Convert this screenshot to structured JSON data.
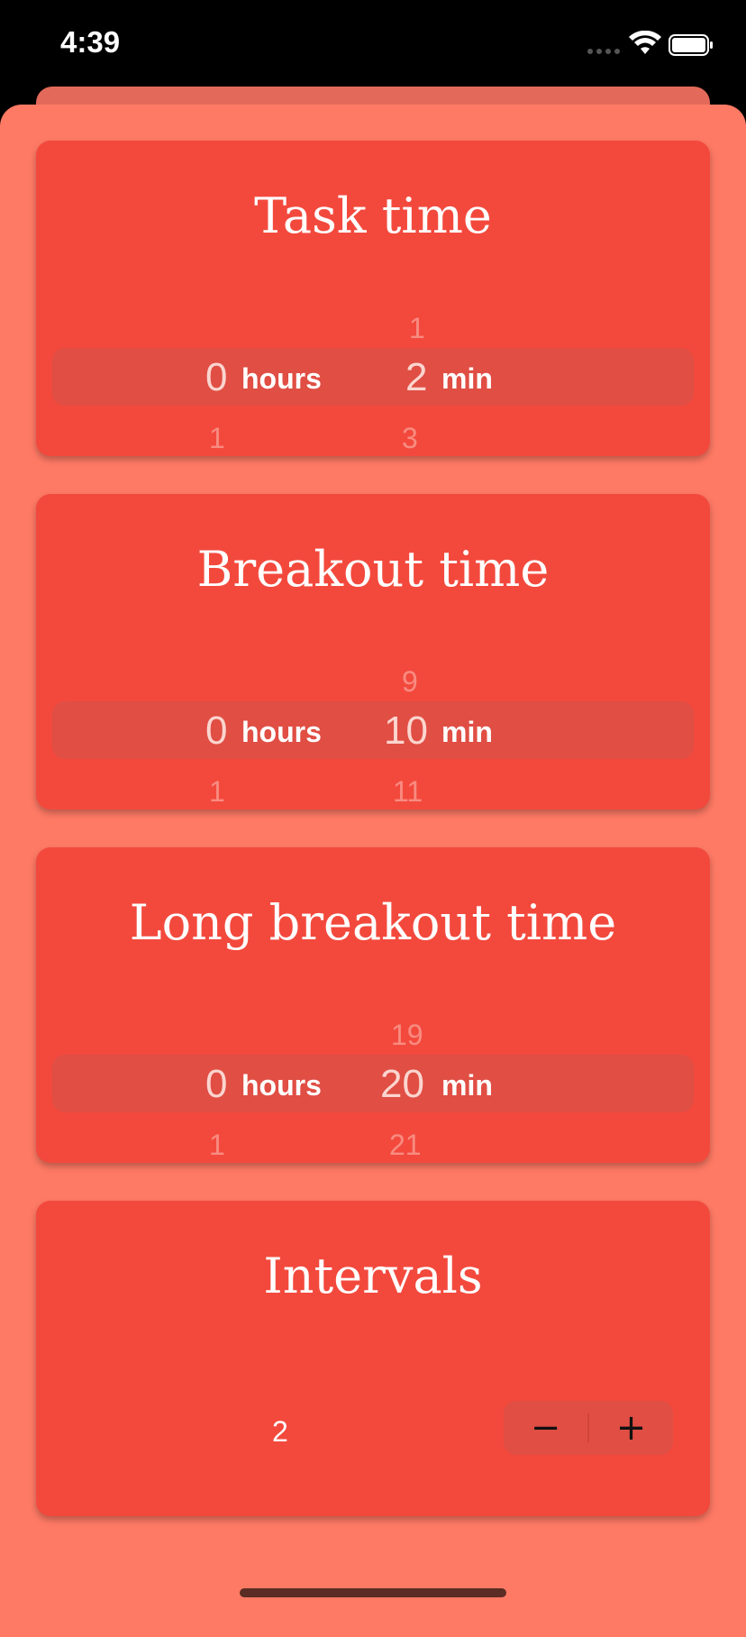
{
  "status": {
    "time": "4:39"
  },
  "cards": {
    "task": {
      "title": "Task time",
      "hours": {
        "above": "",
        "selected": "0",
        "below": "1",
        "unit": "hours"
      },
      "minutes": {
        "above": "1",
        "selected": "2",
        "below": "3",
        "unit": "min"
      }
    },
    "breakout": {
      "title": "Breakout time",
      "hours": {
        "above": "",
        "selected": "0",
        "below": "1",
        "unit": "hours"
      },
      "minutes": {
        "above": "9",
        "selected": "10",
        "below": "11",
        "unit": "min"
      }
    },
    "long_breakout": {
      "title": "Long breakout time",
      "hours": {
        "above": "",
        "selected": "0",
        "below": "1",
        "unit": "hours"
      },
      "minutes": {
        "above": "19",
        "selected": "20",
        "below": "21",
        "unit": "min"
      }
    },
    "intervals": {
      "title": "Intervals",
      "value": "2",
      "decrement": "−",
      "increment": "+"
    }
  },
  "colors": {
    "sheet": "#ff7a65",
    "card": "#f3493d",
    "picker_band": "#e04e44"
  },
  "icons": [
    "signal-icon",
    "wifi-icon",
    "battery-icon",
    "minus-icon",
    "plus-icon"
  ]
}
